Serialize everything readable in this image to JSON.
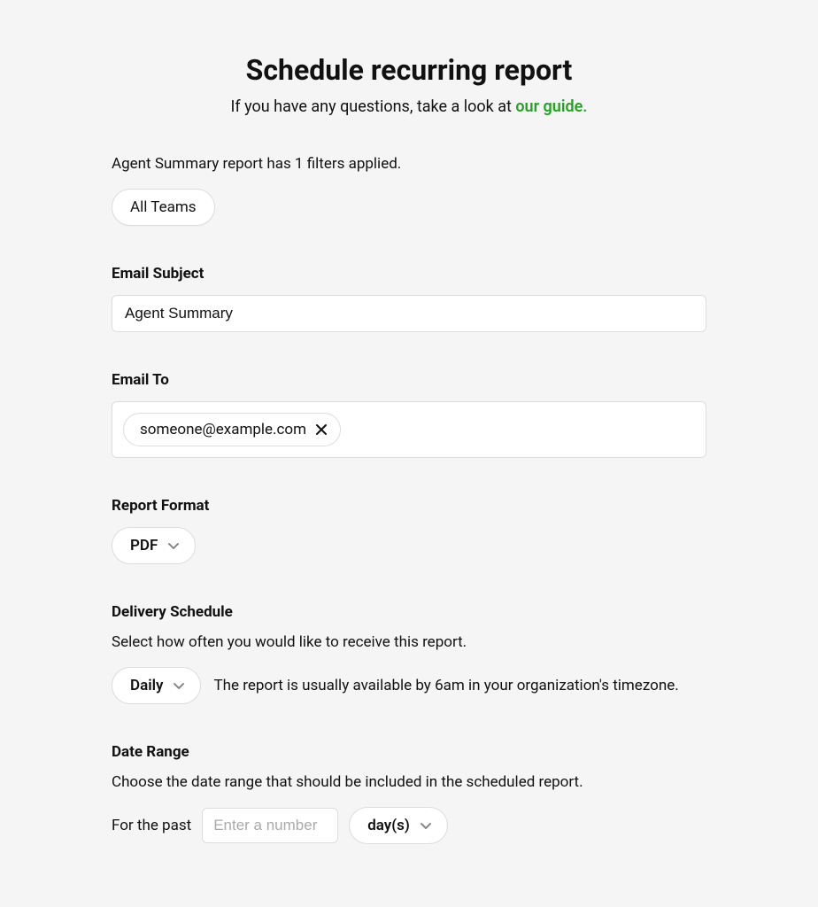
{
  "header": {
    "title": "Schedule recurring report",
    "subtitle_prefix": "If you have any questions, take a look at ",
    "guide_link_text": "our guide."
  },
  "filters": {
    "summary_text": "Agent Summary report has 1 filters applied.",
    "chip_label": "All Teams"
  },
  "email_subject": {
    "label": "Email Subject",
    "value": "Agent Summary"
  },
  "email_to": {
    "label": "Email To",
    "recipients": [
      {
        "email": "someone@example.com"
      }
    ]
  },
  "report_format": {
    "label": "Report Format",
    "selected": "PDF"
  },
  "delivery_schedule": {
    "label": "Delivery Schedule",
    "help_text": "Select how often you would like to receive this report.",
    "selected": "Daily",
    "note": "The report is usually available by 6am in your organization's timezone."
  },
  "date_range": {
    "label": "Date Range",
    "help_text": "Choose the date range that should be included in the scheduled report.",
    "prefix": "For the past",
    "number_placeholder": "Enter a number",
    "number_value": "",
    "unit_selected": "day(s)"
  }
}
